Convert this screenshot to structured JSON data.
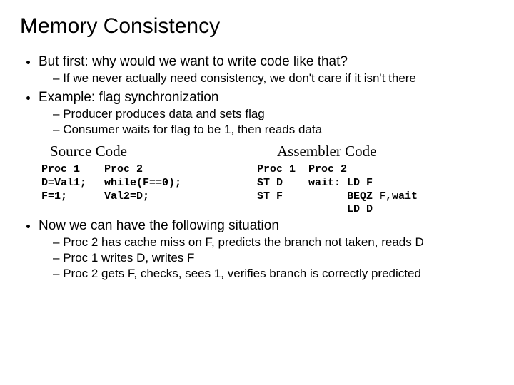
{
  "title": "Memory Consistency",
  "bullets": {
    "b1": "But first: why would we want to write code like that?",
    "b1_s1": "If we never actually need consistency, we don't care if it isn't there",
    "b2": "Example: flag synchronization",
    "b2_s1": "Producer produces data and sets flag",
    "b2_s2": "Consumer waits for flag to be 1, then reads data",
    "b3": "Now we can have the following situation",
    "b3_s1": "Proc 2 has cache miss on F, predicts the branch not taken, reads D",
    "b3_s2": "Proc 1 writes D, writes F",
    "b3_s3": "Proc 2 gets F, checks, sees 1, verifies branch is correctly predicted"
  },
  "source": {
    "label": "Source Code",
    "p1_h": "Proc 1",
    "p1_l1": "D=Val1;",
    "p1_l2": "F=1;",
    "p2_h": "Proc 2",
    "p2_l1": "while(F==0);",
    "p2_l2": "Val2=D;"
  },
  "asm": {
    "label": "Assembler Code",
    "p1_h": "Proc 1",
    "p1_l1": "ST D",
    "p1_l2": "ST F",
    "p2_h": "Proc 2",
    "p2_l1": "wait: LD F",
    "p2_l2": "      BEQZ F,wait",
    "p2_l3": "      LD D"
  }
}
